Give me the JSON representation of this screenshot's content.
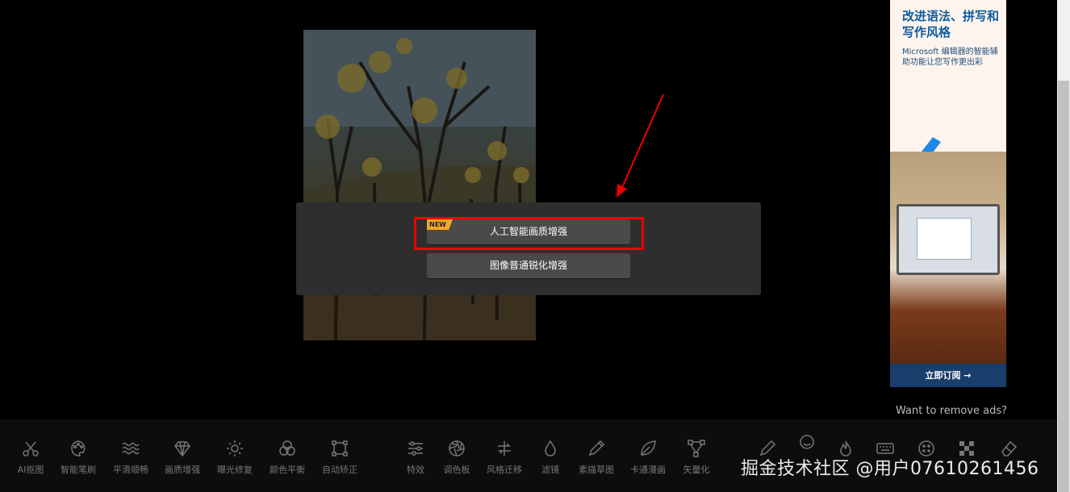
{
  "dialog": {
    "badge": "NEW",
    "option_ai": "人工智能画质增强",
    "option_sharpen": "图像普通锐化增强"
  },
  "ad": {
    "title": "改进语法、拼写和写作风格",
    "subtitle": "Microsoft 编辑器的智能辅助功能让您写作更出彩",
    "cta": "立即订阅 →",
    "remove_ads": "Want to remove ads?"
  },
  "toolbar": {
    "tools": [
      {
        "label": "AI抠图",
        "icon": "scissors-icon"
      },
      {
        "label": "智能笔刷",
        "icon": "palette-icon"
      },
      {
        "label": "平滑顺畅",
        "icon": "waves-icon"
      },
      {
        "label": "画质增强",
        "icon": "diamond-icon"
      },
      {
        "label": "曝光修复",
        "icon": "sun-icon"
      },
      {
        "label": "颜色平衡",
        "icon": "color-circles-icon"
      },
      {
        "label": "自动矫正",
        "icon": "crop-frame-icon"
      },
      {
        "label": "特效",
        "icon": "sliders-icon"
      },
      {
        "label": "调色板",
        "icon": "aperture-icon"
      },
      {
        "label": "风格迁移",
        "icon": "style-transfer-icon"
      },
      {
        "label": "滤镜",
        "icon": "droplet-icon"
      },
      {
        "label": "素描草图",
        "icon": "pencil-sketch-icon"
      },
      {
        "label": "卡通漫画",
        "icon": "leaf-icon"
      },
      {
        "label": "矢量化",
        "icon": "vector-nodes-icon"
      }
    ],
    "extra_icons": [
      "pen-icon",
      "smile-icon",
      "flame-icon",
      "keyboard-icon",
      "grid-circle-icon",
      "checker-icon",
      "eraser-icon"
    ]
  },
  "watermark": "掘金技术社区 @用户07610261456",
  "colors": {
    "highlight": "#e00000",
    "badge": "#f5a623",
    "ad_cta": "#1a3e6b"
  }
}
